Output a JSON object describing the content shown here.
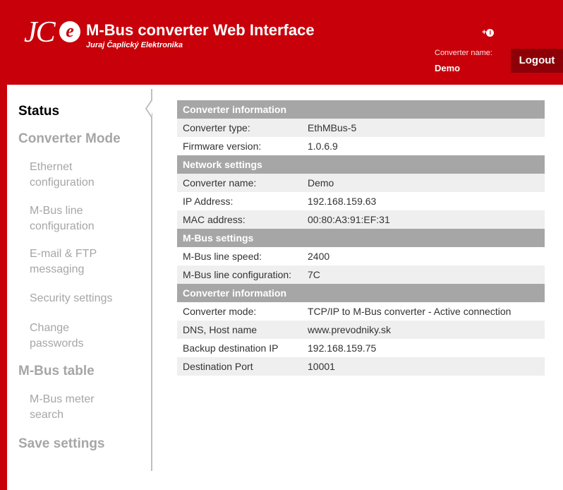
{
  "header": {
    "logo_text": "JC",
    "logo_e": "e",
    "title": "M-Bus converter Web Interface",
    "subtitle": "Juraj Čaplický Elektronika",
    "login_icon": "+",
    "login_icon_glyph": "➊",
    "converter_name_label": "Converter name:",
    "converter_name_value": "Demo",
    "logout_label": "Logout"
  },
  "sidebar": {
    "status": "Status",
    "converter_mode": "Converter Mode",
    "ethernet_l1": "Ethernet",
    "ethernet_l2": "configuration",
    "mbus_line_l1": "M-Bus line",
    "mbus_line_l2": "configuration",
    "email_l1": "E-mail & FTP",
    "email_l2": "messaging",
    "security": "Security settings",
    "change_l1": "Change",
    "change_l2": "passwords",
    "mbus_table": "M-Bus table",
    "meter_l1": "M-Bus meter",
    "meter_l2": "search",
    "save": "Save settings"
  },
  "table": {
    "converter_information": "Converter information",
    "converter_type_label": "Converter type:",
    "converter_type": "EthMBus-5",
    "firmware_label": "Firmware version:",
    "firmware": "1.0.6.9",
    "network_settings": "Network settings",
    "conv_name_label": "Converter name:",
    "conv_name": "Demo",
    "ip_label": "IP Address:",
    "ip": "192.168.159.63",
    "mac_label": "MAC address:",
    "mac": "00:80:A3:91:EF:31",
    "mbus_settings": "M-Bus settings",
    "speed_label": "M-Bus line speed:",
    "speed": "2400",
    "lineconf_label": "M-Bus line configuration:",
    "lineconf": "7C",
    "converter_information_2": "Converter information",
    "mode_label": "Converter mode:",
    "mode": "TCP/IP to M-Bus converter - Active connection",
    "dns_label": "DNS, Host name",
    "dns": "www.prevodniky.sk",
    "backup_label": "Backup destination IP",
    "backup": "192.168.159.75",
    "port_label": "Destination Port",
    "port": "10001"
  },
  "colors": {
    "brand_red": "#c8000a",
    "logout_dark_red": "#8e0008",
    "section_header_gray": "#a6a6a6"
  }
}
